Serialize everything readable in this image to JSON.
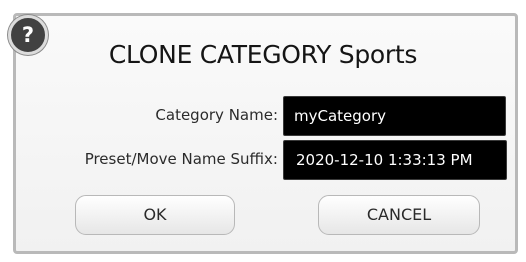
{
  "dialog": {
    "help_icon": "question-mark-icon",
    "help_glyph": "?",
    "title": "CLONE CATEGORY Sports",
    "fields": {
      "category_name": {
        "label": "Category Name:",
        "value": "myCategory"
      },
      "suffix": {
        "label": "Preset/Move Name Suffix:",
        "value": "2020-12-10 1:33:13 PM"
      }
    },
    "buttons": {
      "ok_label": "OK",
      "cancel_label": "CANCEL"
    }
  },
  "colors": {
    "input_background": "#000000",
    "input_text": "#ffffff",
    "dialog_border": "#b9b9b9",
    "help_badge": "#414141"
  }
}
